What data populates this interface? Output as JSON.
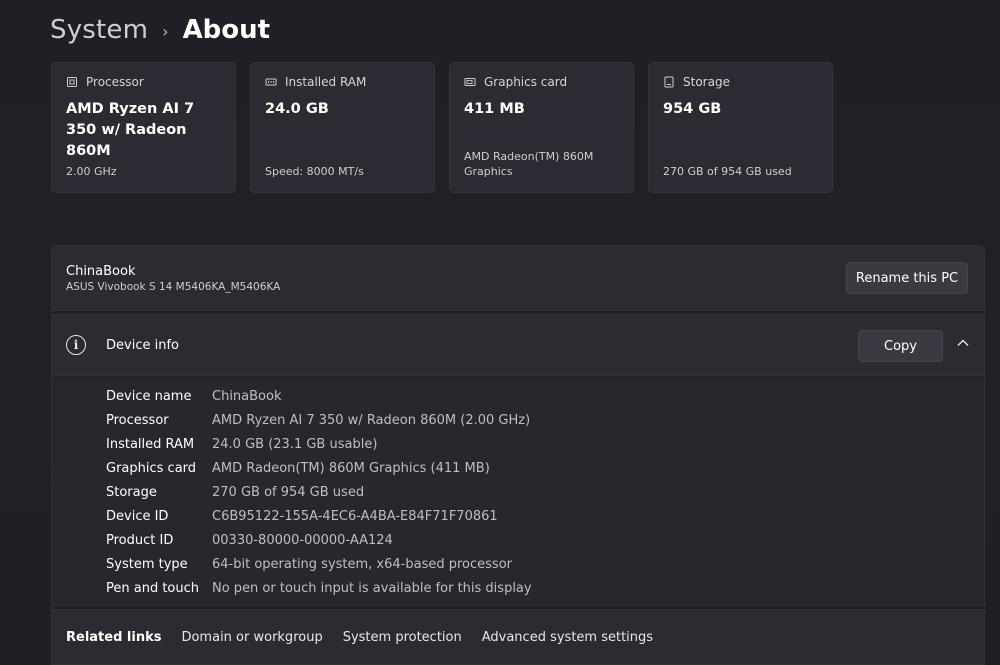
{
  "breadcrumb": {
    "parent": "System",
    "separator": "›",
    "current": "About"
  },
  "cards": [
    {
      "icon": "processor-icon",
      "label": "Processor",
      "value": "AMD Ryzen AI 7 350 w/ Radeon 860M",
      "sub": "2.00 GHz"
    },
    {
      "icon": "ram-icon",
      "label": "Installed RAM",
      "value": "24.0 GB",
      "sub": "Speed: 8000 MT/s"
    },
    {
      "icon": "graphics-card-icon",
      "label": "Graphics card",
      "value": "411 MB",
      "sub": "AMD Radeon(TM) 860M Graphics"
    },
    {
      "icon": "storage-icon",
      "label": "Storage",
      "value": "954 GB",
      "sub": "270 GB of 954 GB used"
    }
  ],
  "pc": {
    "name": "ChinaBook",
    "model": "ASUS Vivobook S 14 M5406KA_M5406KA",
    "rename_label": "Rename this PC"
  },
  "device_info": {
    "title": "Device info",
    "copy_label": "Copy",
    "rows": [
      {
        "key": "Device name",
        "value": "ChinaBook"
      },
      {
        "key": "Processor",
        "value": "AMD Ryzen AI 7 350 w/ Radeon 860M (2.00 GHz)"
      },
      {
        "key": "Installed RAM",
        "value": "24.0 GB (23.1 GB usable)"
      },
      {
        "key": "Graphics card",
        "value": "AMD Radeon(TM) 860M Graphics (411 MB)"
      },
      {
        "key": "Storage",
        "value": "270 GB of 954 GB used"
      },
      {
        "key": "Device ID",
        "value": "C6B95122-155A-4EC6-A4BA-E84F71F70861"
      },
      {
        "key": "Product ID",
        "value": "00330-80000-00000-AA124"
      },
      {
        "key": "System type",
        "value": "64-bit operating system, x64-based processor"
      },
      {
        "key": "Pen and touch",
        "value": "No pen or touch input is available for this display"
      }
    ]
  },
  "related": {
    "title": "Related links",
    "links": [
      "Domain or workgroup",
      "System protection",
      "Advanced system settings"
    ]
  }
}
